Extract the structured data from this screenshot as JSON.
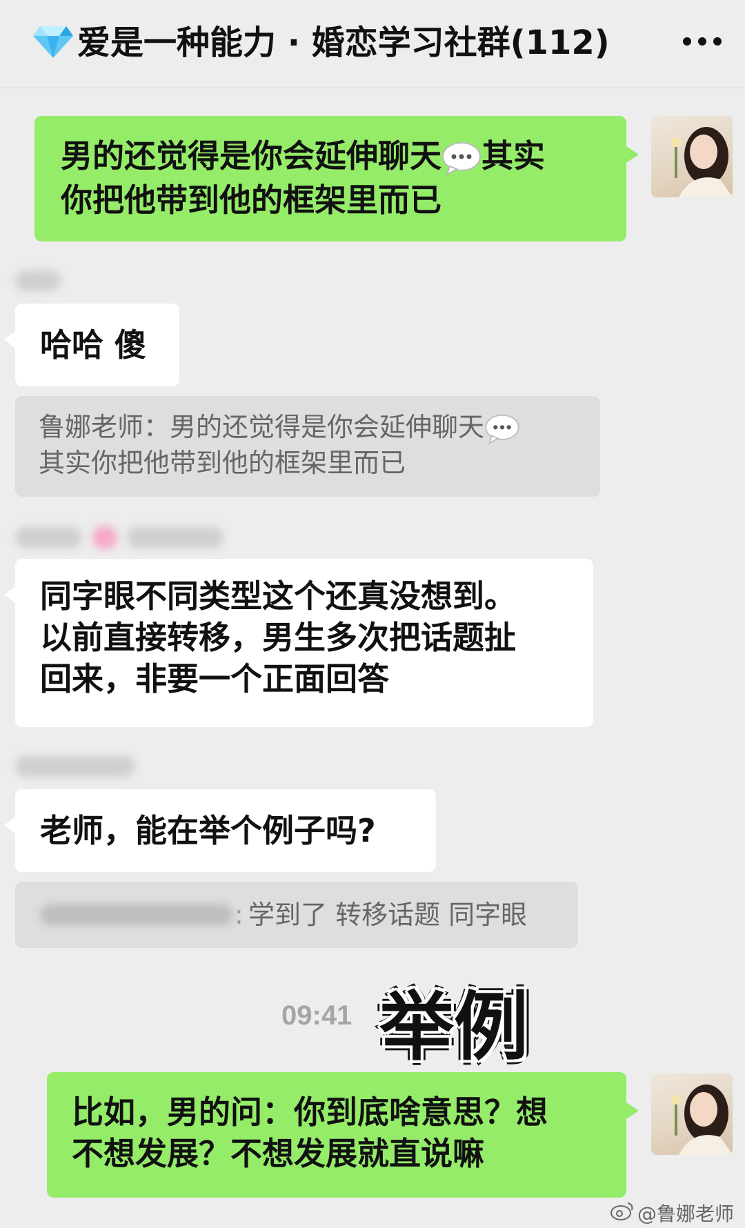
{
  "header": {
    "icon": "diamond-icon",
    "title": "爱是一种能力 · 婚恋学习社群(112)",
    "more_icon": "more-dots-icon"
  },
  "messages": {
    "m1": {
      "line1": "男的还觉得是你会延伸聊天",
      "line1b": "其实",
      "line2": "你把他带到他的框架里而已"
    },
    "m2": {
      "text": "哈哈 傻"
    },
    "q1": {
      "line1": "鲁娜老师：男的还觉得是你会延伸聊天",
      "line2": "其实你把他带到他的框架里而已"
    },
    "m3": {
      "text": "同字眼不同类型这个还真没想到。\n以前直接转移，男生多次把话题扯\n回来，非要一个正面回答"
    },
    "m4": {
      "text": "老师，能在举个例子吗?"
    },
    "q2": {
      "text": "学到了 转移话题 同字眼"
    },
    "timestamp": "09:41",
    "sticker": "举例",
    "m5": {
      "text": "比如，男的问：你到底啥意思？想\n不想发展？不想发展就直说嘛"
    }
  },
  "watermark": "@鲁娜老师",
  "colors": {
    "green_bubble": "#95ec69",
    "background": "#ededed",
    "white_bubble": "#ffffff",
    "quote_bg": "#dedede"
  }
}
